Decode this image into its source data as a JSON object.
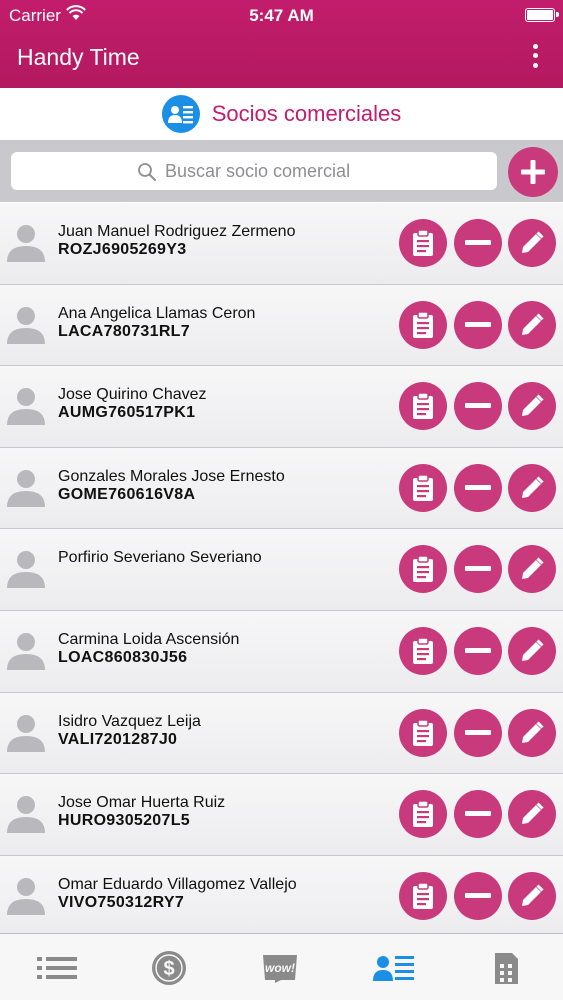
{
  "status_bar": {
    "carrier": "Carrier",
    "time": "5:47 AM"
  },
  "app": {
    "title": "Handy Time",
    "menu_icon": "kebab-menu-icon"
  },
  "section": {
    "title": "Socios comerciales",
    "icon": "contact-card-icon"
  },
  "search": {
    "placeholder": "Buscar socio comercial",
    "value": ""
  },
  "partners": [
    {
      "name": "Juan Manuel Rodriguez Zermeno",
      "rfc": "ROZJ6905269Y3"
    },
    {
      "name": "Ana Angelica Llamas Ceron",
      "rfc": "LACA780731RL7"
    },
    {
      "name": "Jose Quirino Chavez",
      "rfc": "AUMG760517PK1"
    },
    {
      "name": "Gonzales Morales Jose Ernesto",
      "rfc": "GOME760616V8A"
    },
    {
      "name": "Porfirio Severiano Severiano",
      "rfc": ""
    },
    {
      "name": "Carmina Loida Ascensión",
      "rfc": "LOAC860830J56"
    },
    {
      "name": "Isidro Vazquez Leija",
      "rfc": "VALI7201287J0"
    },
    {
      "name": "Jose Omar Huerta Ruiz",
      "rfc": "HURO9305207L5"
    },
    {
      "name": "Omar Eduardo Villagomez Vallejo",
      "rfc": "VIVO750312RY7"
    }
  ],
  "tabs": [
    {
      "icon": "list-icon",
      "active": false
    },
    {
      "icon": "dollar-coin-icon",
      "active": false
    },
    {
      "icon": "wow-tag-icon",
      "label": "wow!",
      "active": false
    },
    {
      "icon": "contact-card-icon",
      "active": true
    },
    {
      "icon": "building-icon",
      "active": false
    }
  ],
  "colors": {
    "brand": "#c21d6c",
    "button": "#c93a7c",
    "active_tab": "#1b8fe6",
    "inactive_tab": "#8a8a8a"
  }
}
